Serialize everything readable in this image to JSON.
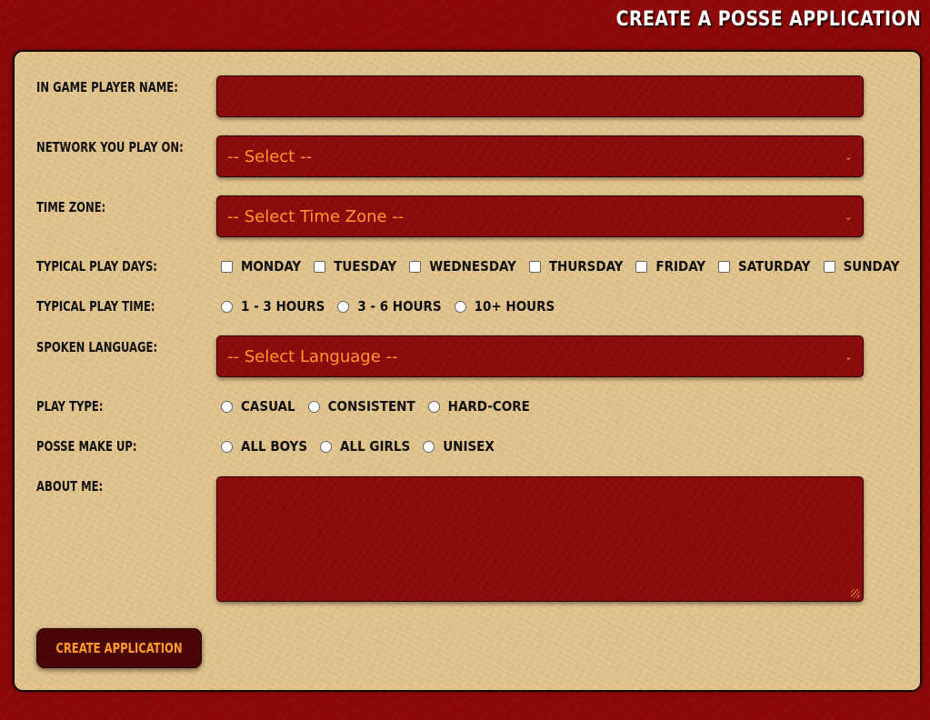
{
  "page": {
    "title": "Create a Posse Application"
  },
  "form": {
    "player_name": {
      "label": "In Game Player Name:",
      "value": ""
    },
    "network": {
      "label": "Network You Play On:",
      "selected": "-- Select --"
    },
    "time_zone": {
      "label": "Time Zone:",
      "selected": "-- Select Time Zone --"
    },
    "play_days": {
      "label": "Typical Play Days:",
      "options": [
        "Monday",
        "Tuesday",
        "Wednesday",
        "Thursday",
        "Friday",
        "Saturday",
        "Sunday"
      ]
    },
    "play_time": {
      "label": "Typical Play Time:",
      "options": [
        "1 - 3 Hours",
        "3 - 6 Hours",
        "10+ Hours"
      ]
    },
    "language": {
      "label": "Spoken Language:",
      "selected": "-- Select Language --"
    },
    "play_type": {
      "label": "Play Type:",
      "options": [
        "Casual",
        "Consistent",
        "Hard-Core"
      ]
    },
    "posse_makeup": {
      "label": "Posse Make Up:",
      "options": [
        "All Boys",
        "All Girls",
        "Unisex"
      ]
    },
    "about_me": {
      "label": "About Me:",
      "value": ""
    },
    "submit_label": "Create Application"
  },
  "colors": {
    "background": "#8e0808",
    "panel": "#e2c48e",
    "field": "#8c0a0a",
    "field_text": "#ff9b2b",
    "button": "#4a0505"
  }
}
